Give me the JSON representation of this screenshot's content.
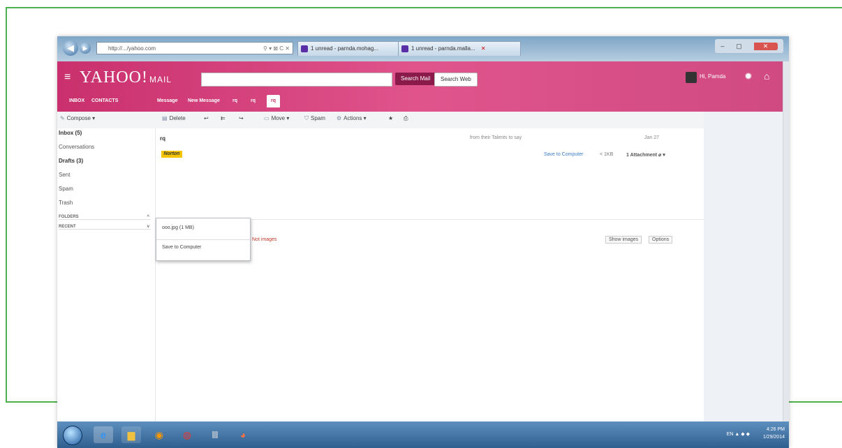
{
  "browser": {
    "address": "http://.../yahoo.com",
    "address_controls": "⚲ ▾ ⊠ C ✕",
    "tabs": [
      "1 unread - parnda.mohag...",
      "1 unread - parnda.malla..."
    ],
    "tab_close": "✕",
    "window_controls": [
      "–",
      "▢",
      "✕"
    ]
  },
  "yahoo": {
    "logo": "YAHOO!",
    "logo_mail": "MAIL",
    "search_mail_label": "Search Mail",
    "search_web_label": "Search Web",
    "username": "Hi, Pamda",
    "nav_tabs": [
      "INBOX",
      "CONTACTS",
      "Message",
      "New Message",
      "rq",
      "rq",
      "rq"
    ]
  },
  "toolbar": {
    "compose": "Compose",
    "delete": "Delete",
    "move": "Move",
    "spam": "Spam",
    "actions": "Actions"
  },
  "sidebar": {
    "items": [
      "Inbox (5)",
      "Conversations",
      "Drafts (3)",
      "Sent",
      "Spam",
      "Trash"
    ],
    "sections": [
      "FOLDERS",
      "RECENT"
    ]
  },
  "message": {
    "subject": "rq",
    "from_note": "from their Talents to say",
    "date": "Jan 27",
    "sender_logo": "Norton",
    "save_to_computer": "Save to Computer",
    "size": "< 1KB",
    "attachments": "1 Attachment",
    "blocked_text": "Not images",
    "show_images": "Show images",
    "options": "Options"
  },
  "dropdown": {
    "item1": "ooo.jpg (1 MB)",
    "item2": "Save to Computer"
  },
  "taskbar": {
    "tray": "EN ▲ ◆ ◆",
    "time": "4:26 PM",
    "date": "1/29/2014"
  }
}
